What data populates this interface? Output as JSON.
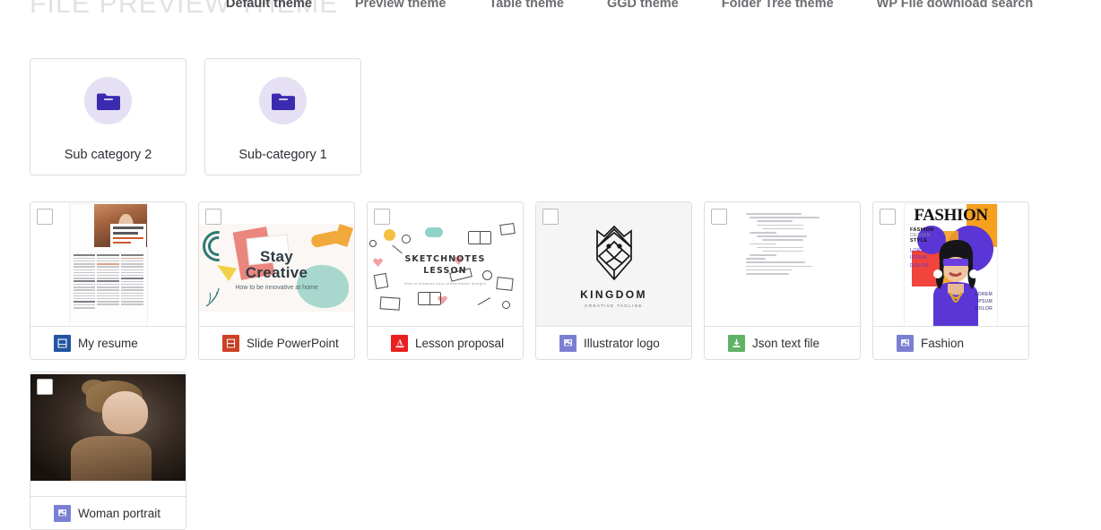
{
  "header": {
    "page_title": "FILE PREVIEW THEME",
    "tabs": [
      {
        "label": "Default theme",
        "active": true
      },
      {
        "label": "Preview theme",
        "active": false
      },
      {
        "label": "Table theme",
        "active": false
      },
      {
        "label": "GGD theme",
        "active": false
      },
      {
        "label": "Folder Tree theme",
        "active": false
      },
      {
        "label": "WP File download search",
        "active": false
      }
    ]
  },
  "colors": {
    "folder_icon": "#3b2bb0",
    "folder_circle": "#e6e0f4",
    "card_border": "#dedede",
    "word_icon": "#2155a4",
    "powerpoint_icon": "#cc4125",
    "pdf_icon": "#e8201f",
    "image_icon": "#7b7fd4",
    "json_icon": "#5fb364",
    "title_text": "#e2e2e4",
    "tab_text": "#6d6d72"
  },
  "folders": [
    {
      "name": "Sub category 2",
      "icon": "folder-icon"
    },
    {
      "name": "Sub-category 1",
      "icon": "folder-icon"
    }
  ],
  "files": [
    {
      "name": "My resume",
      "type": "word",
      "icon": "word-document-icon",
      "checked": false,
      "thumbnail": {
        "kind": "resume",
        "texts": [
          "Mariana Napolitani",
          "Fashion Designer"
        ]
      }
    },
    {
      "name": "Slide PowerPoint",
      "type": "powerpoint",
      "icon": "powerpoint-slide-icon",
      "checked": false,
      "thumbnail": {
        "kind": "powerpoint",
        "title_line1": "Stay",
        "title_line2": "Creative",
        "subtitle": "How to be innovative at home"
      }
    },
    {
      "name": "Lesson proposal",
      "type": "pdf",
      "icon": "pdf-document-icon",
      "checked": false,
      "thumbnail": {
        "kind": "sketchnotes",
        "title_line1": "SKETCHNOTES",
        "title_line2": "LESSON",
        "subtitle": "How to enhance your presentation designs"
      }
    },
    {
      "name": "Illustrator logo",
      "type": "image",
      "icon": "image-file-icon",
      "checked": false,
      "thumbnail": {
        "kind": "kingdom-logo",
        "brand": "KINGDOM",
        "tagline": "CREATIVE TAGLINE"
      }
    },
    {
      "name": "Json text file",
      "type": "json",
      "icon": "json-file-icon",
      "checked": false,
      "thumbnail": {
        "kind": "json-code",
        "line_widths": [
          62,
          78,
          40,
          52,
          46,
          30,
          56,
          46,
          30,
          52,
          46,
          30,
          22,
          66,
          74,
          52,
          48
        ]
      }
    },
    {
      "name": "Fashion",
      "type": "image",
      "icon": "image-file-icon",
      "checked": false,
      "thumbnail": {
        "kind": "fashion-cover",
        "title": "FASHION",
        "block": [
          "FASHION",
          "DESIGN",
          "STYLE"
        ],
        "lorem": "LOREM<br>IPSUM<br>DOLOR",
        "lorem2": "LOREM<br>IPSUM<br>DOLOR"
      }
    },
    {
      "name": "Woman portrait",
      "type": "image",
      "icon": "image-file-icon",
      "checked": false,
      "thumbnail": {
        "kind": "portrait-photo"
      }
    }
  ]
}
